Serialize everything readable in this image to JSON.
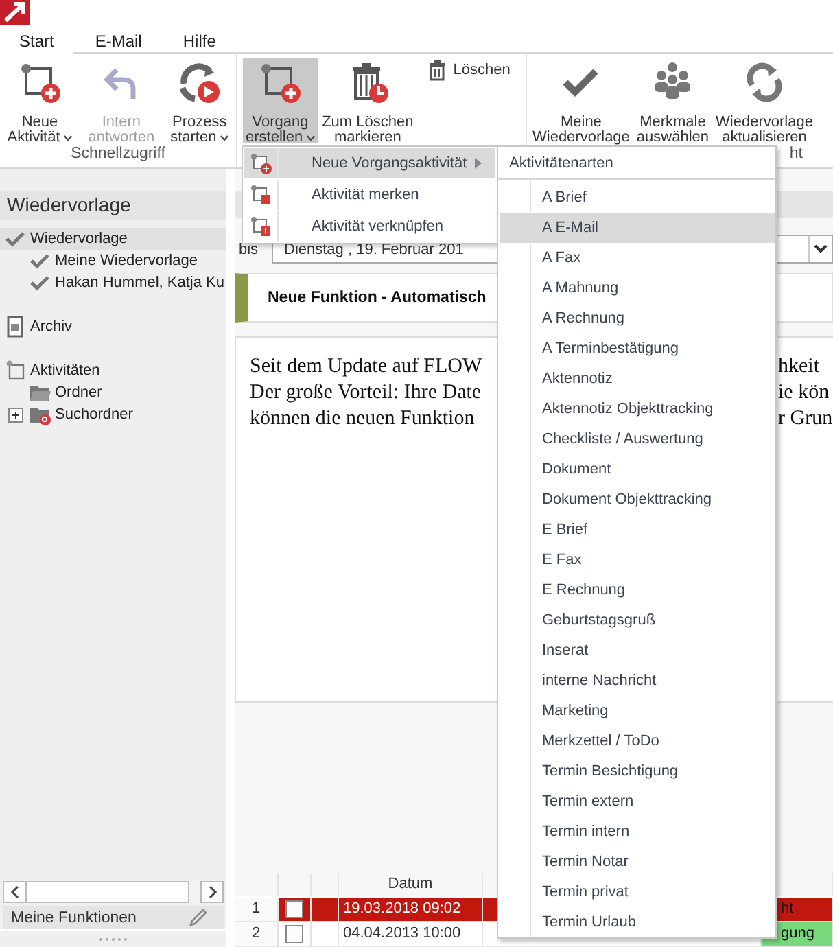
{
  "tabs": [
    {
      "label": "Start",
      "selected": true
    },
    {
      "label": "E-Mail",
      "selected": false
    },
    {
      "label": "Hilfe",
      "selected": false
    }
  ],
  "ribbon": [
    {
      "label": "Schnellzugriff",
      "buttons": [
        {
          "label": "Neue\nAktivität",
          "kind": "large",
          "menu": true,
          "disabled": false,
          "pressed": false
        },
        {
          "label": "Intern\nantworten",
          "kind": "large",
          "menu": false,
          "disabled": true,
          "pressed": false
        },
        {
          "label": "Prozess\nstarten",
          "kind": "large",
          "menu": true,
          "disabled": false,
          "pressed": false
        }
      ]
    },
    {
      "buttons": [
        {
          "label": "Vorgang\nerstellen",
          "kind": "large",
          "menu": true,
          "disabled": false,
          "pressed": true
        },
        {
          "label": "Zum Löschen\nmarkieren",
          "kind": "large",
          "menu": false,
          "disabled": false,
          "pressed": false
        },
        {
          "label": "Löschen",
          "kind": "small",
          "menu": false,
          "disabled": false,
          "pressed": false
        }
      ]
    },
    {
      "label": "ht",
      "buttons": [
        {
          "label": "Meine\nWiedervorlage",
          "kind": "large",
          "menu": false,
          "disabled": false,
          "pressed": false
        },
        {
          "label": "Merkmale\nauswählen",
          "kind": "large",
          "menu": false,
          "disabled": false,
          "pressed": false
        },
        {
          "label": "Wiedervorlage\naktualisieren",
          "kind": "large",
          "menu": false,
          "disabled": false,
          "pressed": false
        }
      ]
    }
  ],
  "sidebar": {
    "title": "Wiedervorlage",
    "tree": [
      {
        "label": "Wiedervorlage",
        "kind": "check",
        "selected": true,
        "children": [
          {
            "label": "Meine Wiedervorlage",
            "kind": "check",
            "selected": false
          },
          {
            "label": "Hakan Hummel, Katja Ku",
            "kind": "check",
            "selected": false
          }
        ]
      },
      {
        "label": "Archiv",
        "kind": "archive",
        "selected": false
      },
      {
        "label": "Aktivitäten",
        "kind": "activity",
        "selected": false,
        "children": [
          {
            "label": "Ordner",
            "kind": "folder",
            "selected": false
          },
          {
            "label": "Suchordner",
            "kind": "search-folder",
            "selected": false,
            "expanded": false
          }
        ]
      }
    ],
    "footer": "Meine Funktionen"
  },
  "main": {
    "date": {
      "label": "bis",
      "value": "Dienstag , 19. Februar 201"
    },
    "news": {
      "title": "Neue Funktion - Automatisch",
      "text_left": [
        "Seit dem Update auf FLOW",
        "Der große Vorteil: Ihre Date",
        "können die neuen Funktion"
      ],
      "text_right": [
        "hkeit",
        "ie kön",
        "r Grun"
      ]
    },
    "table": {
      "columns": [
        "Datum"
      ],
      "rows": [
        {
          "number": "1",
          "checked": false,
          "selected": true,
          "date": "19.03.2018 09:02",
          "status": "ht",
          "color": "#c0170f"
        },
        {
          "number": "2",
          "checked": false,
          "selected": false,
          "date": "04.04.2013 10:00",
          "status": "gung",
          "color": "#77d97b"
        }
      ]
    }
  },
  "context_menu": {
    "items": [
      {
        "label": "Neue Vorgangsaktivität",
        "selected": true,
        "submenu": true
      },
      {
        "label": "Aktivität merken",
        "selected": false,
        "submenu": false
      },
      {
        "label": "Aktivität verknüpfen",
        "selected": false,
        "submenu": false
      }
    ]
  },
  "submenu": {
    "title": "Aktivitätenarten",
    "items": [
      {
        "label": "A Brief",
        "selected": false
      },
      {
        "label": "A E-Mail",
        "selected": true
      },
      {
        "label": "A Fax",
        "selected": false
      },
      {
        "label": "A Mahnung",
        "selected": false
      },
      {
        "label": "A Rechnung",
        "selected": false
      },
      {
        "label": "A Terminbestätigung",
        "selected": false
      },
      {
        "label": "Aktennotiz",
        "selected": false
      },
      {
        "label": "Aktennotiz Objekttracking",
        "selected": false
      },
      {
        "label": "Checkliste / Auswertung",
        "selected": false
      },
      {
        "label": "Dokument",
        "selected": false
      },
      {
        "label": "Dokument Objekttracking",
        "selected": false
      },
      {
        "label": "E Brief",
        "selected": false
      },
      {
        "label": "E Fax",
        "selected": false
      },
      {
        "label": "E Rechnung",
        "selected": false
      },
      {
        "label": "Geburtstagsgruß",
        "selected": false
      },
      {
        "label": "Inserat",
        "selected": false
      },
      {
        "label": "interne Nachricht",
        "selected": false
      },
      {
        "label": "Marketing",
        "selected": false
      },
      {
        "label": "Merkzettel / ToDo",
        "selected": false
      },
      {
        "label": "Termin Besichtigung",
        "selected": false
      },
      {
        "label": "Termin extern",
        "selected": false
      },
      {
        "label": "Termin intern",
        "selected": false
      },
      {
        "label": "Termin Notar",
        "selected": false
      },
      {
        "label": "Termin privat",
        "selected": false
      },
      {
        "label": "Termin Urlaub",
        "selected": false
      }
    ]
  }
}
